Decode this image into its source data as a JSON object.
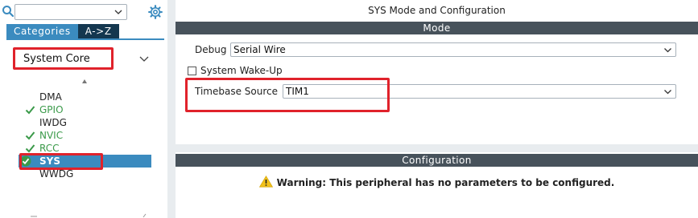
{
  "left_panel": {
    "search": {
      "value": "",
      "placeholder": ""
    },
    "tabs": [
      {
        "label": "Categories",
        "active": true
      },
      {
        "label": "A->Z",
        "active": false
      }
    ],
    "category": {
      "selected": "System Core"
    },
    "peripherals": [
      {
        "label": "DMA",
        "state": "normal"
      },
      {
        "label": "GPIO",
        "state": "enabled"
      },
      {
        "label": "IWDG",
        "state": "normal"
      },
      {
        "label": "NVIC",
        "state": "enabled"
      },
      {
        "label": "RCC",
        "state": "enabled"
      },
      {
        "label": "SYS",
        "state": "selected"
      },
      {
        "label": "WWDG",
        "state": "normal"
      }
    ]
  },
  "right_panel": {
    "title": "SYS Mode and Configuration",
    "mode_section": {
      "header": "Mode",
      "debug": {
        "label": "Debug",
        "value": "Serial Wire"
      },
      "system_wakeup": {
        "label": "System Wake-Up",
        "checked": false
      },
      "timebase": {
        "label": "Timebase Source",
        "value": "TIM1"
      }
    },
    "configuration_section": {
      "header": "Configuration",
      "warning": "Warning: This peripheral has no parameters to be configured."
    }
  },
  "colors": {
    "accent_blue": "#3b8bbf",
    "dark_navy": "#14374f",
    "section_bar": "#47525b",
    "enabled_green": "#3b9a4a",
    "highlight_red": "#e0222b",
    "warning_yellow": "#f2c21b"
  },
  "icons": {
    "search": "search-icon",
    "gear": "gear-icon",
    "chevron": "chevron-down-icon",
    "check": "check-icon",
    "warning": "warning-icon"
  }
}
